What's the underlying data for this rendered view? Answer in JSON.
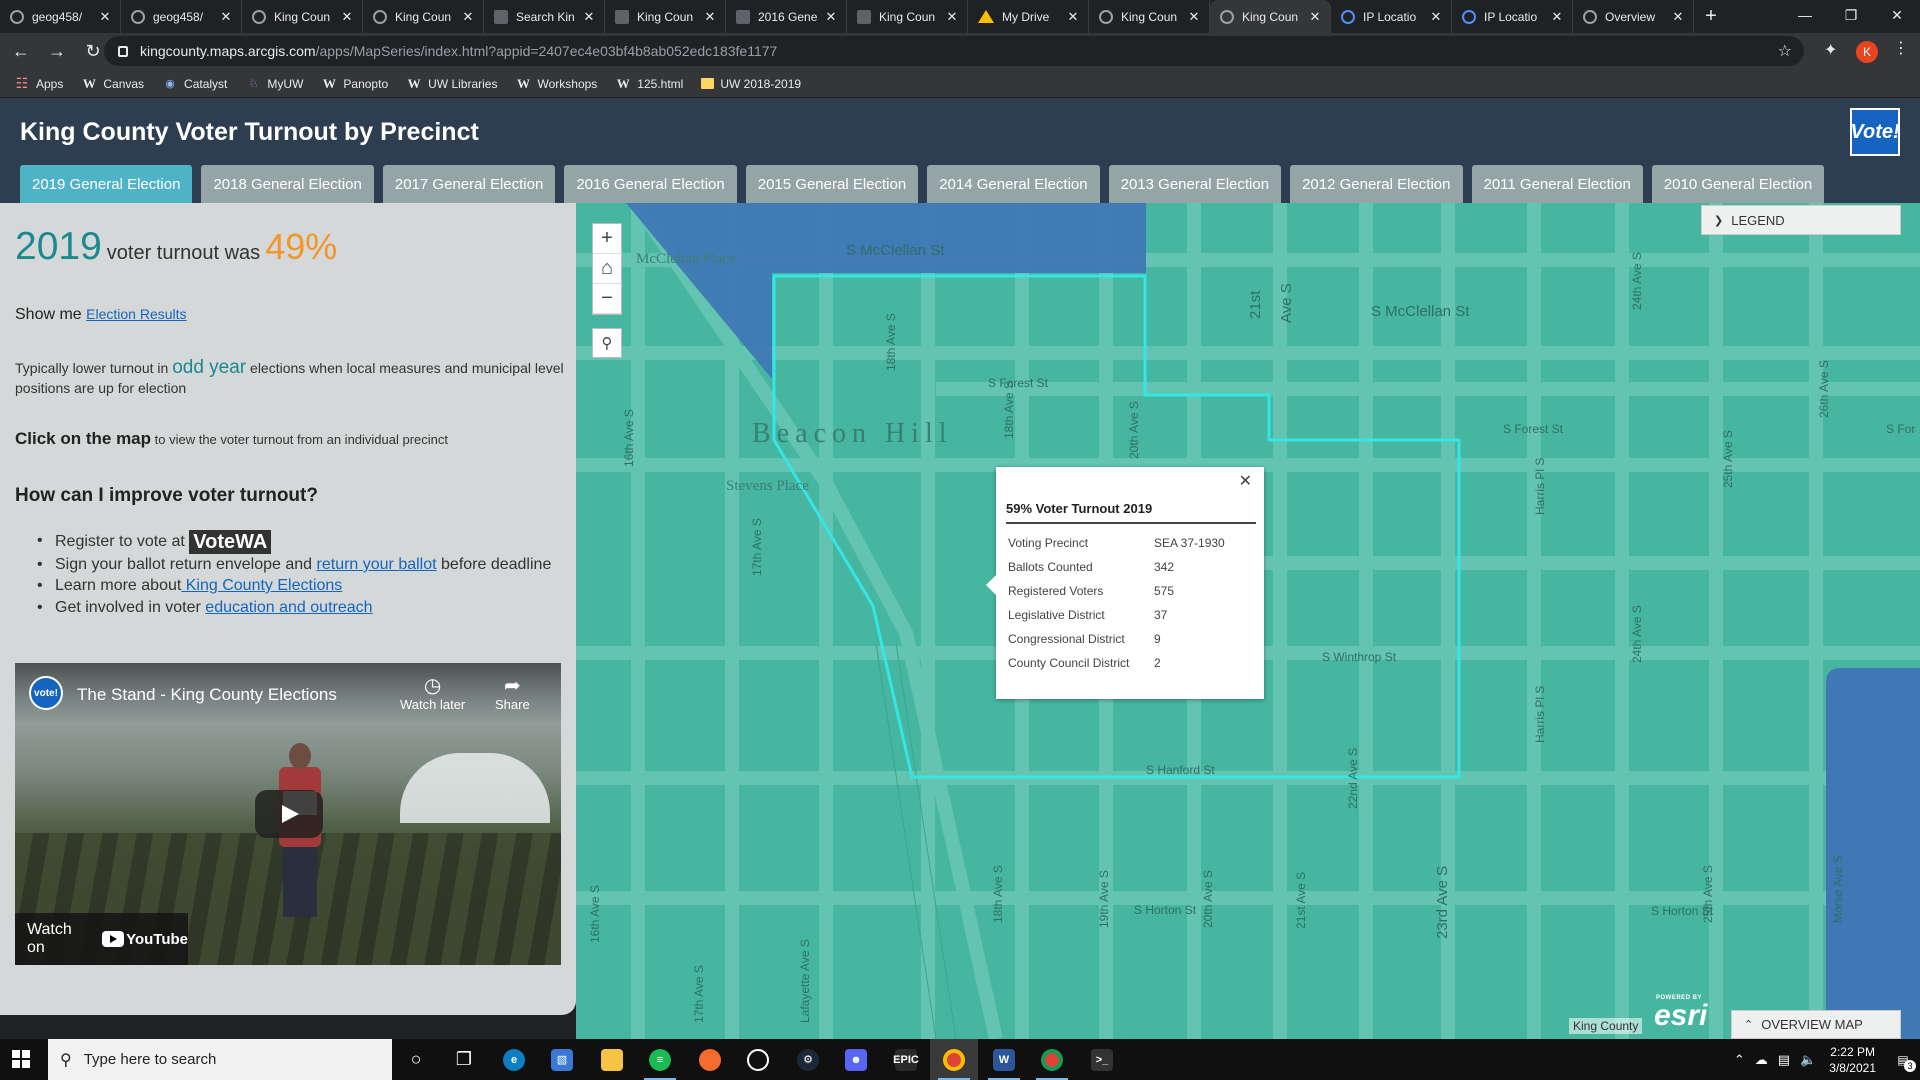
{
  "browser": {
    "tabs": [
      {
        "title": "geog458/",
        "icon": "github-icon",
        "active": false
      },
      {
        "title": "geog458/",
        "icon": "github-icon",
        "active": false
      },
      {
        "title": "King Coun",
        "icon": "arcgis-globe-icon",
        "active": false
      },
      {
        "title": "King Coun",
        "icon": "arcgis-globe-icon",
        "active": false
      },
      {
        "title": "Search Kin",
        "icon": "doc-icon",
        "active": false
      },
      {
        "title": "King Coun",
        "icon": "doc-icon",
        "active": false
      },
      {
        "title": "2016 Gene",
        "icon": "doc-icon",
        "active": false
      },
      {
        "title": "King Coun",
        "icon": "doc-icon",
        "active": false
      },
      {
        "title": "My Drive",
        "icon": "google-drive-icon",
        "active": false
      },
      {
        "title": "King Coun",
        "icon": "arcgis-globe-icon",
        "active": false
      },
      {
        "title": "King Coun",
        "icon": "arcgis-globe-icon",
        "active": true
      },
      {
        "title": "IP Locatio",
        "icon": "ip-location-icon",
        "active": false
      },
      {
        "title": "IP Locatio",
        "icon": "ip-location-icon",
        "active": false
      },
      {
        "title": "Overview",
        "icon": "arcgis-globe-icon",
        "active": false
      }
    ],
    "new_tab_symbol": "+",
    "url_host": "kingcounty.maps.arcgis.com",
    "url_path": "/apps/MapSeries/index.html?appid=2407ec4e03bf4b8ab052edc183fe1177",
    "profile_initial": "K",
    "bookmarks": [
      {
        "label": "Apps",
        "icon": "apps-grid-icon"
      },
      {
        "label": "Canvas",
        "icon": "uw-w-icon"
      },
      {
        "label": "Catalyst",
        "icon": "catalyst-icon"
      },
      {
        "label": "MyUW",
        "icon": "myuw-icon"
      },
      {
        "label": "Panopto",
        "icon": "uw-w-icon"
      },
      {
        "label": "UW Libraries",
        "icon": "uw-w-icon"
      },
      {
        "label": "Workshops",
        "icon": "uw-w-icon"
      },
      {
        "label": "125.html",
        "icon": "uw-w-icon"
      },
      {
        "label": "UW 2018-2019",
        "icon": "folder-icon"
      }
    ]
  },
  "app": {
    "title": "King County Voter Turnout by Precinct",
    "logo_text": "Vote!",
    "election_tabs": [
      "2019 General Election",
      "2018 General Election",
      "2017 General Election",
      "2016 General Election",
      "2015 General Election",
      "2014 General Election",
      "2013 General Election",
      "2012 General Election",
      "2011 General Election",
      "2010 General Election"
    ],
    "active_tab_index": 0
  },
  "panel": {
    "stat_year": "2019",
    "stat_middle": "voter turnout was",
    "stat_percent": "49%",
    "show_me_label": "Show me",
    "show_me_link": "Election Results",
    "typically_before": "Typically lower turnout in ",
    "typically_odd": "odd year",
    "typically_after": " elections when local measures and municipal level positions are up for election",
    "click_bold": "Click on the map",
    "click_rest": " to view the voter turnout from an individual precinct",
    "improve_heading": "How can I improve voter turnout?",
    "register_text": "Register to vote at ",
    "register_logo": "VoteWA",
    "sign_before": "Sign your ballot return envelope and ",
    "sign_link": "return your ballot",
    "sign_after": " before deadline",
    "learn_before": "Learn more about",
    "learn_link": " King County Elections",
    "involved_before": "Get involved in voter ",
    "involved_link": "education and outreach",
    "video": {
      "channel_icon_text": "vote!",
      "title": "The Stand - King County Elections",
      "watch_later": "Watch later",
      "share": "Share",
      "watch_on": "Watch on",
      "youtube": "YouTube"
    }
  },
  "map": {
    "street_labels": {
      "mcclellan_top": "S McClellan St",
      "mcclellan_right": "S McClellan St",
      "forest_left": "S Forest St",
      "forest_right": "S Forest St",
      "forest_far": "S For",
      "winthrop": "S Winthrop St",
      "hanford": "S Hanford St",
      "horton_mid": "S Horton St",
      "horton_right": "S Horton St",
      "ave21": "21st",
      "ave21b": "Ave S",
      "ave18": "18th Ave S",
      "ave18b": "18th Ave S",
      "ave20": "20th Ave S",
      "ave16": "16th Ave S",
      "ave17": "17th Ave S",
      "ave22": "22nd Ave S",
      "ave23": "23rd Ave S",
      "ave24": "24th Ave S",
      "ave25": "25th Ave S",
      "ave26": "26th Ave S",
      "harris": "Harris Pl S",
      "lafayette": "Lafayette Ave S",
      "ave19": "19th Ave S",
      "ave20b": "20th Ave S",
      "ave21c": "21st Ave S",
      "ave16b": "16th Ave S",
      "ave17b": "17th Ave S",
      "morse": "Morse Ave S"
    },
    "area_labels": {
      "beacon": "Beacon Hill",
      "stevens": "Stevens Place",
      "mcclellan_place": "McClellan Place"
    },
    "legend_label": "LEGEND",
    "overview_label": "OVERVIEW MAP",
    "attribution": "King County",
    "esri_powered": "POWERED BY",
    "esri": "esri",
    "colors": {
      "map_fill": "#46b6a0",
      "low_turnout": "#3f78b5",
      "precinct_outline": "#34e6e6"
    },
    "popup": {
      "title": "59% Voter Turnout 2019",
      "rows": [
        {
          "k": "Voting Precinct",
          "v": "SEA 37-1930"
        },
        {
          "k": "Ballots Counted",
          "v": "342"
        },
        {
          "k": "Registered Voters",
          "v": "575"
        },
        {
          "k": "Legislative District",
          "v": "37"
        },
        {
          "k": "Congressional District",
          "v": "9"
        },
        {
          "k": "County Council District",
          "v": "2"
        }
      ]
    }
  },
  "taskbar": {
    "search_placeholder": "Type here to search",
    "time": "2:22 PM",
    "date": "3/8/2021",
    "notification_count": "3"
  }
}
